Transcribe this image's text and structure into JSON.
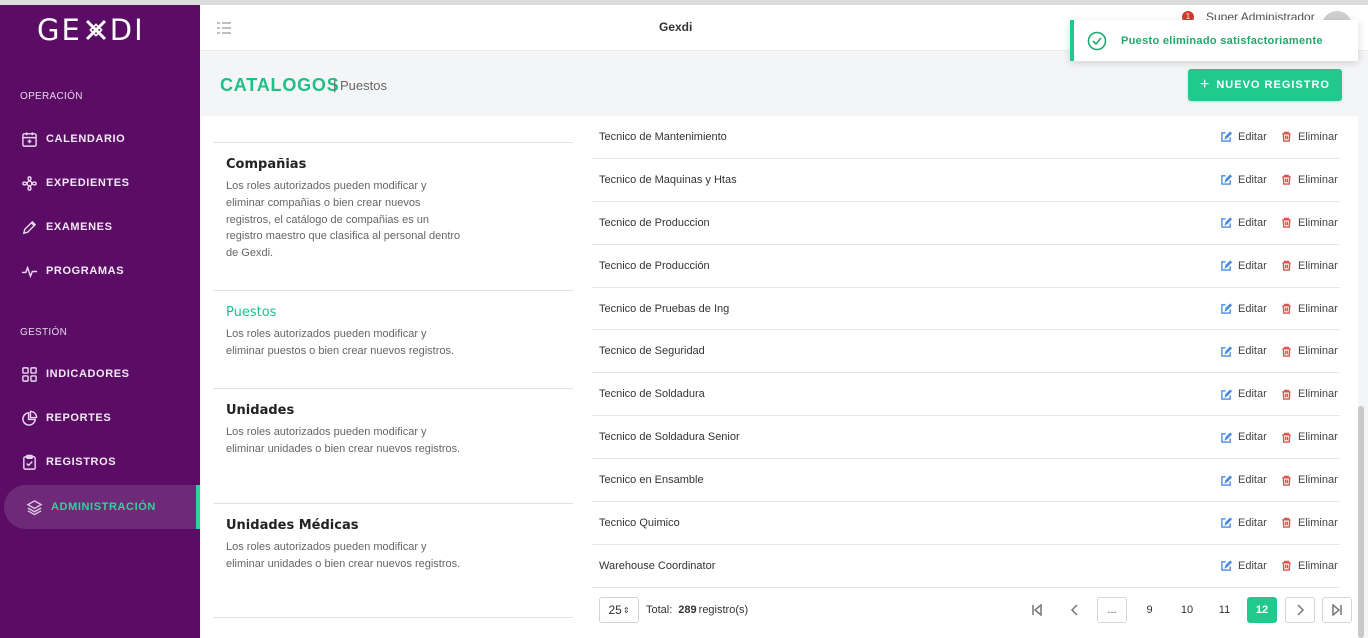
{
  "app": {
    "title": "Gexdi",
    "logo": "GEXDI"
  },
  "header": {
    "notifications_count": "1",
    "user_name": "Super Administrador"
  },
  "sidebar": {
    "sections": [
      {
        "label": "OPERACIÓN"
      },
      {
        "label": "GESTIÓN"
      }
    ],
    "items": [
      {
        "label": "CALENDARIO",
        "icon": "calendar-icon"
      },
      {
        "label": "EXPEDIENTES",
        "icon": "expedientes-icon"
      },
      {
        "label": "EXAMENES",
        "icon": "pen-icon"
      },
      {
        "label": "PROGRAMAS",
        "icon": "pulse-icon"
      },
      {
        "label": "INDICADORES",
        "icon": "grid-icon"
      },
      {
        "label": "REPORTES",
        "icon": "pie-chart-icon"
      },
      {
        "label": "REGISTROS",
        "icon": "clipboard-icon"
      },
      {
        "label": "ADMINISTRACIÓN",
        "icon": "layers-icon",
        "active": true
      }
    ]
  },
  "page": {
    "title": "CATALOGOS",
    "subtitle": "| Puestos",
    "new_button": "NUEVO REGISTRO"
  },
  "catalogs": [
    {
      "title": "Compañias",
      "description": "Los roles autorizados pueden modificar y eliminar compañias o bien crear nuevos registros, el catálogo de compañias es un registro maestro que clasifica al personal dentro de Gexdi."
    },
    {
      "title": "Puestos",
      "description": "Los roles autorizados pueden modificar y eliminar puestos o bien crear nuevos registros.",
      "selected": true
    },
    {
      "title": "Unidades",
      "description": "Los roles autorizados pueden modificar y eliminar unidades o bien crear nuevos registros."
    },
    {
      "title": "Unidades Médicas",
      "description": "Los roles autorizados pueden modificar y eliminar unidades o bien crear nuevos registros."
    }
  ],
  "table": {
    "edit_label": "Editar",
    "delete_label": "Eliminar",
    "rows": [
      "Tecnico de Mantenimiento",
      "Tecnico de Maquinas y Htas",
      "Tecnico de Produccion",
      "Tecnico de Producción",
      "Tecnico de Pruebas de Ing",
      "Tecnico de Seguridad",
      "Tecnico de Soldadura",
      "Tecnico de Soldadura Senior",
      "Tecnico en Ensamble",
      "Tecnico Quimico",
      "Warehouse Coordinator"
    ]
  },
  "pagination": {
    "page_size": "25",
    "total_label": "Total:",
    "total_count": "289",
    "total_suffix": "registro(s)",
    "ellipsis": "...",
    "pages": [
      "9",
      "10",
      "11",
      "12"
    ],
    "current_page": "12"
  },
  "toast": {
    "message": "Puesto eliminado satisfactoriamente"
  },
  "colors": {
    "sidebar": "#5b0d66",
    "accent": "#22c98e",
    "edit": "#4a8cdb",
    "delete": "#e05252"
  }
}
